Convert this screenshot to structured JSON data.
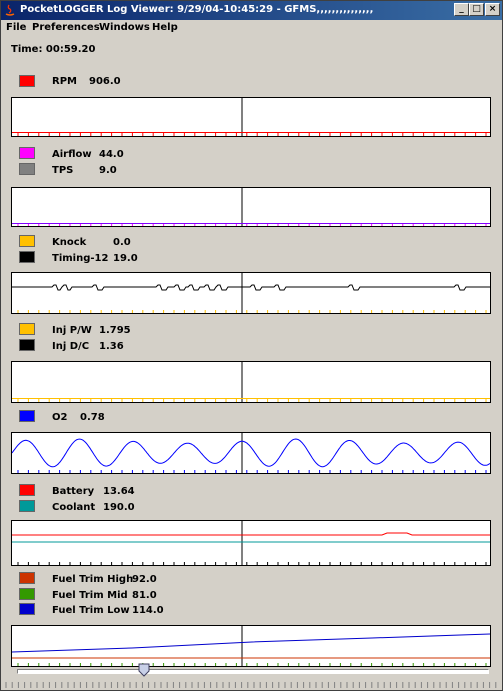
{
  "window": {
    "title": "PocketLOGGER Log Viewer: 9/29/04-10:45:29 - GFMS,,,,,,,,,,,,,,,"
  },
  "menu": [
    {
      "label": "File"
    },
    {
      "label": "Preferences"
    },
    {
      "label": "Windows"
    },
    {
      "label": "Help"
    }
  ],
  "time": {
    "label": "Time: 00:59.20"
  },
  "panels": [
    {
      "channels": [
        {
          "name": "RPM",
          "value": "906.0",
          "color": "#ff0000"
        }
      ],
      "tick_color": "#ff0000"
    },
    {
      "channels": [
        {
          "name": "Airflow",
          "value": "44.0",
          "color": "#ff00ff"
        },
        {
          "name": "TPS",
          "value": "9.0",
          "color": "#808080"
        }
      ],
      "tick_color": "#ff00ff"
    },
    {
      "channels": [
        {
          "name": "Knock",
          "value": "0.0",
          "color": "#ffc000"
        },
        {
          "name": "Timing-12",
          "value": "19.0",
          "color": "#000000"
        }
      ],
      "tick_color": "#ffc000"
    },
    {
      "channels": [
        {
          "name": "Inj P/W",
          "value": "1.795",
          "color": "#ffc000"
        },
        {
          "name": "Inj D/C",
          "value": "1.36",
          "color": "#000000"
        }
      ],
      "tick_color": "#ffc000"
    },
    {
      "channels": [
        {
          "name": "O2",
          "value": "0.78",
          "color": "#0000ff"
        }
      ],
      "tick_color": "#0000ff"
    },
    {
      "channels": [
        {
          "name": "Battery",
          "value": "13.64",
          "color": "#ff0000"
        },
        {
          "name": "Coolant",
          "value": "190.0",
          "color": "#009999"
        }
      ],
      "tick_color": "#000000"
    },
    {
      "channels": [
        {
          "name": "Fuel Trim High",
          "value": "92.0",
          "color": "#cc3300"
        },
        {
          "name": "Fuel Trim Mid",
          "value": "81.0",
          "color": "#339900"
        },
        {
          "name": "Fuel Trim Low",
          "value": "114.0",
          "color": "#0000cc"
        }
      ],
      "tick_color": "#339900"
    }
  ],
  "colors": {
    "titlebar_start": "#0a246a",
    "titlebar_end": "#3a6ea5",
    "window_bg": "#d4d0c8"
  },
  "icons": {
    "minimize": "minimize-icon",
    "maximize": "maximize-icon",
    "close": "close-icon",
    "app": "java-app-icon"
  }
}
